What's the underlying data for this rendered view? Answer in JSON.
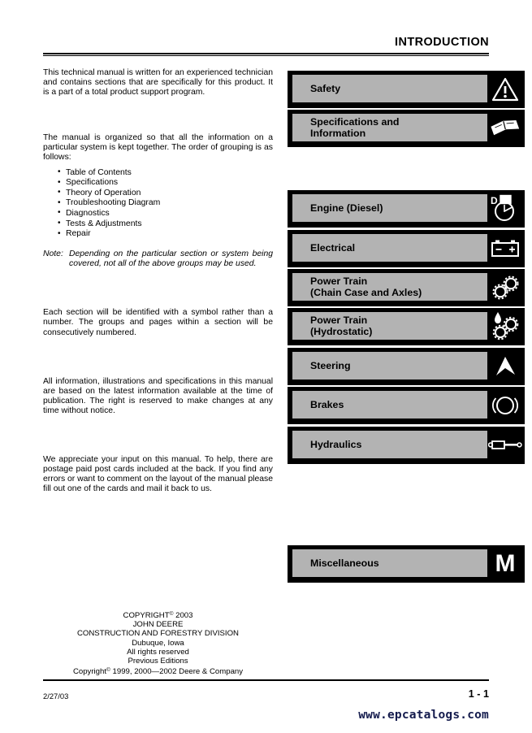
{
  "header": {
    "title": "INTRODUCTION"
  },
  "body": {
    "paragraph_1": "This technical manual is written for an experienced technician and contains sections that are specifically for this product. It is a part of a total product support program.",
    "paragraph_2": "The manual is organized so that all the information on a particular system is kept together. The order of grouping is as follows:",
    "bullets": [
      "Table of Contents",
      "Specifications",
      "Theory of Operation",
      "Troubleshooting Diagram",
      "Diagnostics",
      "Tests & Adjustments",
      "Repair"
    ],
    "note_label": "Note:",
    "note_text": "Depending on the particular section or system being covered, not all of the above groups may be used.",
    "paragraph_3": "Each section will be identified with a symbol rather than a number. The groups and pages within a section will be consecutively numbered.",
    "paragraph_4": "All information, illustrations and specifications in this manual are based on the latest information available at the time of publication. The right is reserved to make changes at any time without notice.",
    "paragraph_5": "We appreciate your input on this manual. To help, there are postage paid post cards included at the back. If you find any errors or want to comment on the layout of the manual please fill out one of the cards and mail it back to us."
  },
  "copyright": {
    "line_1_pre": "COPYRIGHT",
    "line_1_sup": "©",
    "line_1_post": " 2003",
    "line_2": "JOHN DEERE",
    "line_3": "CONSTRUCTION AND FORESTRY DIVISION",
    "line_4": "Dubuque, Iowa",
    "line_5": "All rights reserved",
    "line_6": "Previous Editions",
    "line_7_pre": "Copyright",
    "line_7_sup": "©",
    "line_7_post": " 1999, 2000—2002 Deere & Company"
  },
  "footer": {
    "date": "2/27/03",
    "page": "1 - 1",
    "watermark": "www.epcatalogs.com"
  },
  "sections": [
    {
      "label": "Safety",
      "icon": "warning-triangle-icon"
    },
    {
      "label": "Specifications and\nInformation",
      "icon": "specifications-book-icon"
    },
    {
      "label": "Engine (Diesel)",
      "icon": "diesel-engine-icon"
    },
    {
      "label": "Electrical",
      "icon": "battery-icon"
    },
    {
      "label": "Power Train\n(Chain Case and Axles)",
      "icon": "gears-icon"
    },
    {
      "label": "Power Train\n(Hydrostatic)",
      "icon": "gears-with-oil-drop-icon"
    },
    {
      "label": "Steering",
      "icon": "steering-hub-icon"
    },
    {
      "label": "Brakes",
      "icon": "brake-disc-icon"
    },
    {
      "label": "Hydraulics",
      "icon": "hydraulic-cylinder-icon"
    },
    {
      "label": "Miscellaneous",
      "icon": "letter-m-icon"
    }
  ],
  "colors": {
    "panel_gray": "#b3b3b3",
    "frame_black": "#000000",
    "watermark": "#141b4d"
  }
}
